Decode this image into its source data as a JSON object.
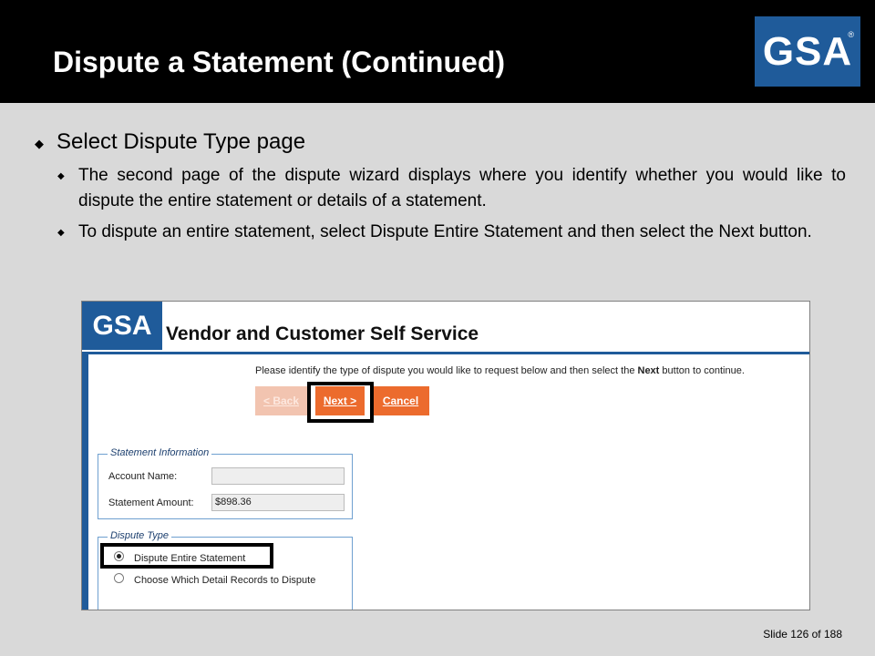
{
  "slide": {
    "title": "Dispute a Statement (Continued)",
    "logo": "GSA",
    "logo_mark": "®",
    "bullet1": "Select Dispute Type page",
    "bullet2": "The second page of the dispute wizard displays where you identify whether you would like to dispute the entire statement or details of a statement.",
    "bullet3": "To dispute an entire statement, select Dispute Entire Statement and then select the Next button.",
    "footer_slide": "Slide 126",
    "footer_of": "of 188"
  },
  "screenshot": {
    "logo": "GSA",
    "app_title": "Vendor and Customer Self Service",
    "instruction_pre": "Please identify the type of dispute you would like to request below and then select the ",
    "instruction_bold": "Next",
    "instruction_post": " button to continue.",
    "buttons": {
      "back": "< Back",
      "next": "Next >",
      "cancel": "Cancel"
    },
    "statement_info": {
      "legend": "Statement Information",
      "account_name_label": "Account Name:",
      "account_name_value": "",
      "statement_amount_label": "Statement Amount:",
      "statement_amount_value": "$898.36"
    },
    "dispute_type": {
      "legend": "Dispute Type",
      "option1": "Dispute Entire Statement",
      "option2": "Choose Which Detail Records to Dispute",
      "selected": "Dispute Entire Statement"
    }
  },
  "colors": {
    "brand_blue": "#1f5b9a",
    "button_orange": "#ec6b2d",
    "title_bar": "#000000",
    "background": "#d9d9d9"
  }
}
